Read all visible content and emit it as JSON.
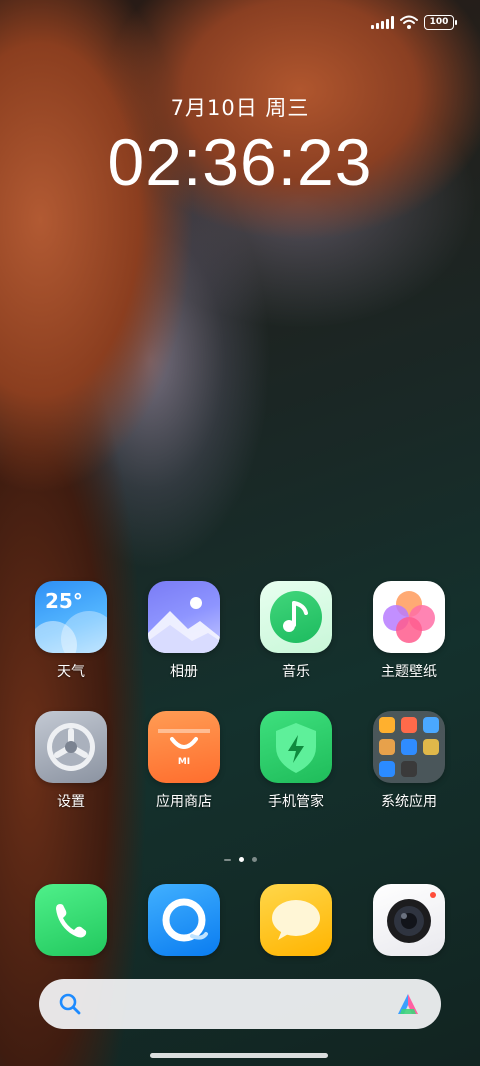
{
  "status_bar": {
    "battery": "100"
  },
  "lockscreen": {
    "date": "7月10日 周三",
    "time": "02:36:23"
  },
  "apps": [
    {
      "label": "天气",
      "icon": "weather-icon",
      "temp": "25°"
    },
    {
      "label": "相册",
      "icon": "gallery-icon"
    },
    {
      "label": "音乐",
      "icon": "music-icon"
    },
    {
      "label": "主题壁纸",
      "icon": "themes-icon"
    },
    {
      "label": "设置",
      "icon": "settings-icon"
    },
    {
      "label": "应用商店",
      "icon": "app-store-icon",
      "badge": "MI"
    },
    {
      "label": "手机管家",
      "icon": "security-icon"
    },
    {
      "label": "系统应用",
      "icon": "folder-icon"
    }
  ],
  "dock": [
    {
      "icon": "phone-icon"
    },
    {
      "icon": "browser-icon"
    },
    {
      "icon": "messages-icon"
    },
    {
      "icon": "camera-icon"
    }
  ],
  "search": {
    "icon": "search-icon",
    "assistant_icon": "assistant-icon"
  },
  "pager": {
    "pages": 3,
    "active": 1
  },
  "colors": {
    "accent": "#1e8bff",
    "green": "#22c85e",
    "orange": "#ff7a35"
  }
}
